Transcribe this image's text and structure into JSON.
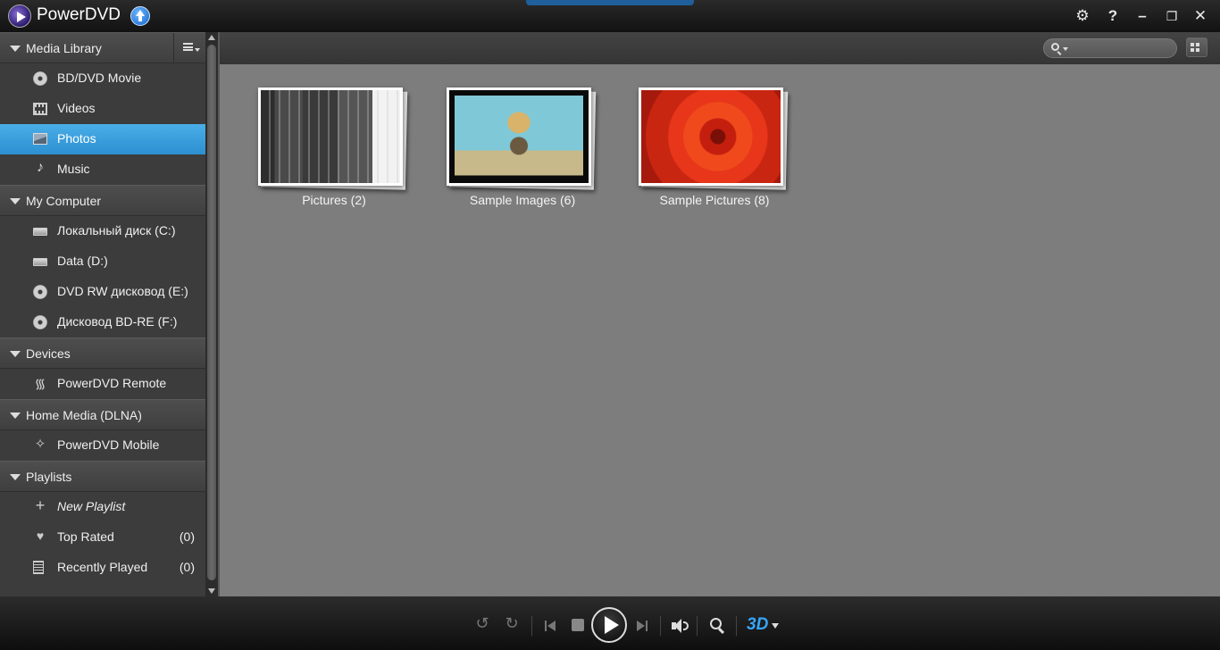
{
  "app": {
    "title": "PowerDVD"
  },
  "sidebar": {
    "sections": [
      {
        "label": "Media Library",
        "items": [
          {
            "label": "BD/DVD Movie",
            "icon": "disc-icon"
          },
          {
            "label": "Videos",
            "icon": "film-icon"
          },
          {
            "label": "Photos",
            "icon": "photo-icon",
            "selected": true
          },
          {
            "label": "Music",
            "icon": "music-note-icon"
          }
        ]
      },
      {
        "label": "My Computer",
        "items": [
          {
            "label": "Локальный диск (C:)",
            "icon": "hard-drive-icon"
          },
          {
            "label": "Data (D:)",
            "icon": "hard-drive-icon"
          },
          {
            "label": "DVD RW дисковод (E:)",
            "icon": "disc-icon"
          },
          {
            "label": "Дисковод BD-RE (F:)",
            "icon": "disc-icon"
          }
        ]
      },
      {
        "label": "Devices",
        "items": [
          {
            "label": "PowerDVD Remote",
            "icon": "remote-signal-icon"
          }
        ]
      },
      {
        "label": "Home Media (DLNA)",
        "items": [
          {
            "label": "PowerDVD Mobile",
            "icon": "mobile-device-icon"
          }
        ]
      },
      {
        "label": "Playlists",
        "items": [
          {
            "label": "New Playlist",
            "icon": "plus-icon"
          },
          {
            "label": "Top Rated",
            "icon": "heart-icon",
            "count": "(0)"
          },
          {
            "label": "Recently Played",
            "icon": "list-icon",
            "count": "(0)"
          }
        ]
      }
    ]
  },
  "main": {
    "folders": [
      {
        "label": "Pictures (2)",
        "thumbnail": "circuit-board-photo"
      },
      {
        "label": "Sample Images (6)",
        "thumbnail": "swing-ride-photo"
      },
      {
        "label": "Sample Pictures (8)",
        "thumbnail": "red-flower-photo"
      }
    ]
  },
  "colors": {
    "selected": "#3a9fe0",
    "sidebar_bg": "#3c3c3c",
    "content_bg": "#7d7d7d",
    "accent_3d": "#37a6ff"
  }
}
